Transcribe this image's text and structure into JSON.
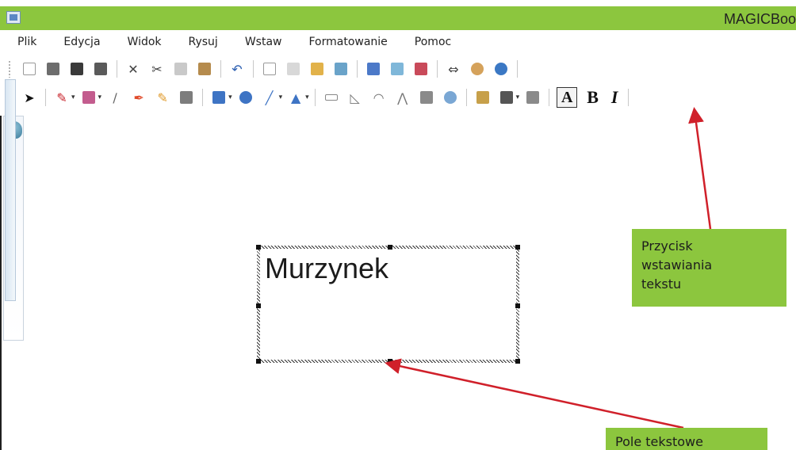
{
  "window": {
    "title": "MAGICBoo"
  },
  "menu": [
    "Plik",
    "Edycja",
    "Widok",
    "Rysuj",
    "Wstaw",
    "Formatowanie",
    "Pomoc"
  ],
  "toolbar2": {
    "text_tool": "A",
    "bold": "B",
    "italic": "I"
  },
  "canvas": {
    "textbox_text": "Murzynek"
  },
  "annotations": {
    "text_button_label": [
      "Przycisk",
      "wstawiania",
      "tekstu"
    ],
    "textbox_label": "Pole tekstowe"
  },
  "colors": {
    "titlebar": "#8cc63e",
    "callout": "#8cc63e",
    "arrow": "#d0202a"
  }
}
